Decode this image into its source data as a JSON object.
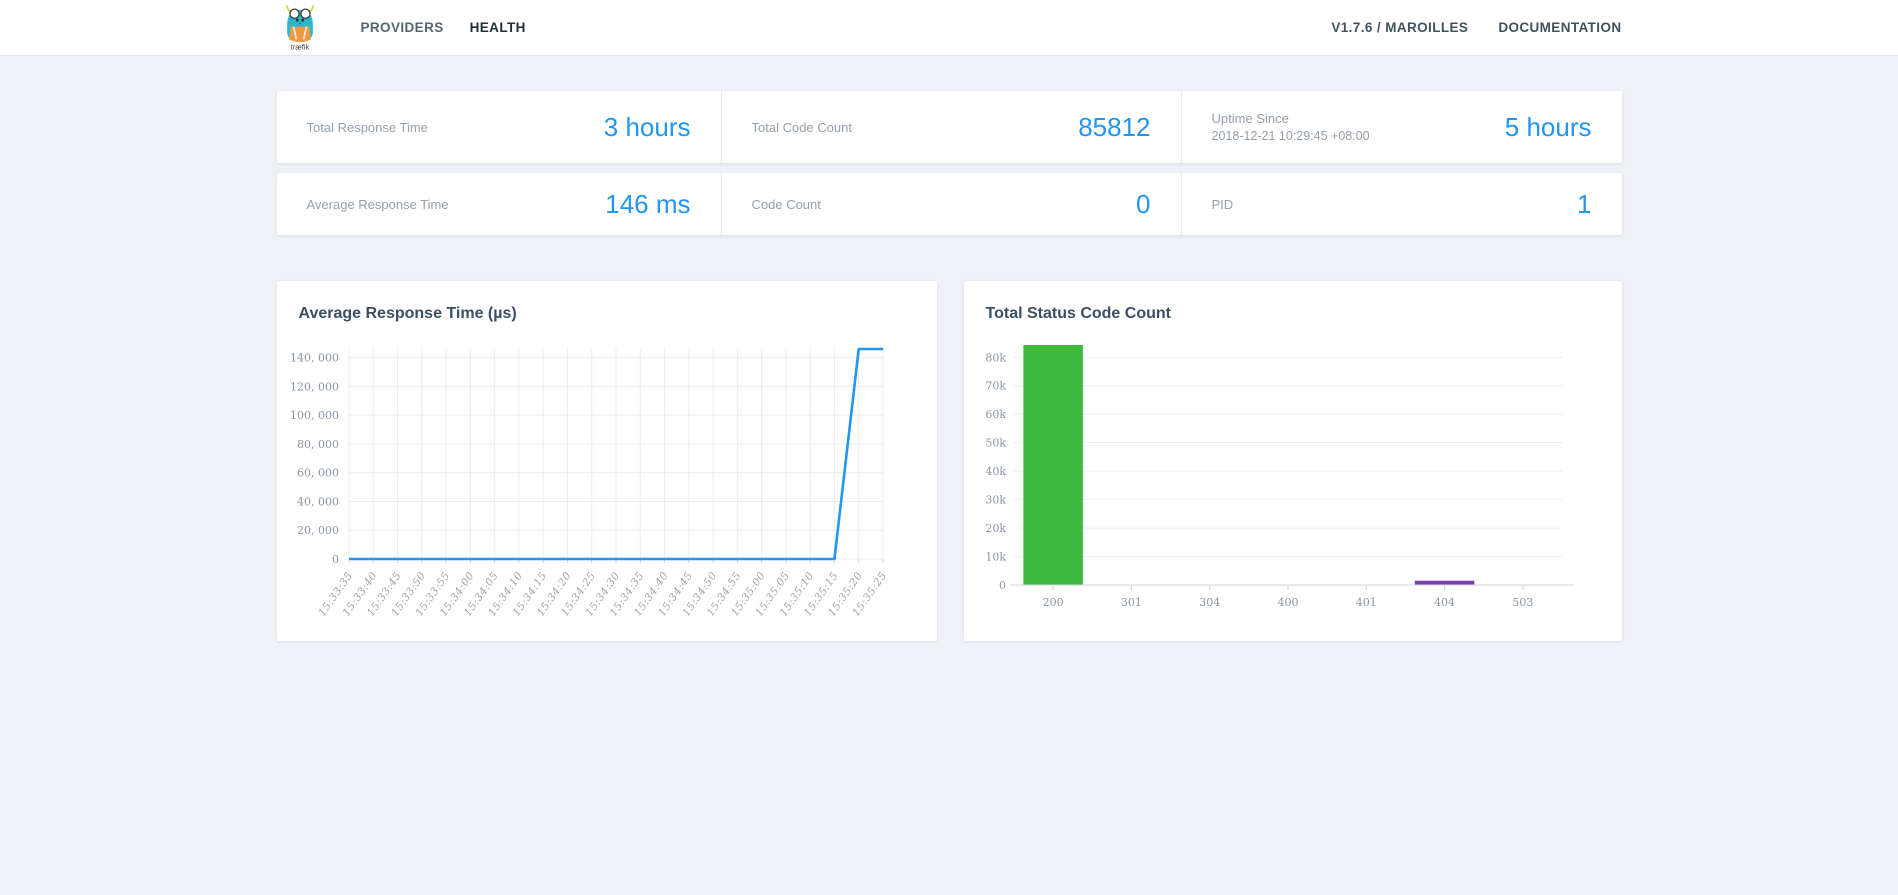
{
  "navbar": {
    "logo_text": "træfik",
    "links": [
      {
        "label": "PROVIDERS",
        "active": false
      },
      {
        "label": "HEALTH",
        "active": true
      }
    ],
    "version": "V1.7.6 / MAROILLES",
    "documentation": "DOCUMENTATION"
  },
  "stats": {
    "row1": [
      {
        "label": "Total Response Time",
        "value": "3 hours"
      },
      {
        "label": "Total Code Count",
        "value": "85812"
      },
      {
        "label": "Uptime Since",
        "sublabel": "2018-12-21 10:29:45 +08:00",
        "value": "5 hours"
      }
    ],
    "row2": [
      {
        "label": "Average Response Time",
        "value": "146 ms"
      },
      {
        "label": "Code Count",
        "value": "0"
      },
      {
        "label": "PID",
        "value": "1"
      }
    ]
  },
  "colors": {
    "accent_blue": "#2196f3",
    "bar_green": "#3eba3e",
    "bar_purple": "#7d3cae"
  },
  "chart_data": [
    {
      "type": "line",
      "title": "Average Response Time (µs)",
      "x": [
        "15:33:35",
        "15:33:40",
        "15:33:45",
        "15:33:50",
        "15:33:55",
        "15:34:00",
        "15:34:05",
        "15:34:10",
        "15:34:15",
        "15:34:20",
        "15:34:25",
        "15:34:30",
        "15:34:35",
        "15:34:40",
        "15:34:45",
        "15:34:50",
        "15:34:55",
        "15:35:00",
        "15:35:05",
        "15:35:10",
        "15:35:15",
        "15:35:20",
        "15:35:25"
      ],
      "values": [
        0,
        0,
        0,
        0,
        0,
        0,
        0,
        0,
        0,
        0,
        0,
        0,
        0,
        0,
        0,
        0,
        0,
        0,
        0,
        0,
        0,
        146000,
        146000
      ],
      "ylim": [
        0,
        146000
      ],
      "y_ticks": [
        [
          0,
          "0"
        ],
        [
          20000,
          "20, 000"
        ],
        [
          40000,
          "40, 000"
        ],
        [
          60000,
          "60, 000"
        ],
        [
          80000,
          "80, 000"
        ],
        [
          100000,
          "100, 000"
        ],
        [
          120000,
          "120, 000"
        ],
        [
          140000,
          "140, 000"
        ]
      ],
      "line_color": "#2196f3",
      "grid": true,
      "legend": "none"
    },
    {
      "type": "bar",
      "title": "Total Status Code Count",
      "categories": [
        "200",
        "301",
        "304",
        "400",
        "401",
        "404",
        "503"
      ],
      "values": [
        84312,
        0,
        0,
        0,
        0,
        1500,
        0
      ],
      "ylim": [
        0,
        84312
      ],
      "y_ticks": [
        [
          0,
          "0"
        ],
        [
          10000,
          "10k"
        ],
        [
          20000,
          "20k"
        ],
        [
          30000,
          "30k"
        ],
        [
          40000,
          "40k"
        ],
        [
          50000,
          "50k"
        ],
        [
          60000,
          "60k"
        ],
        [
          70000,
          "70k"
        ],
        [
          80000,
          "80k"
        ]
      ],
      "colors": {
        "200": "#3eba3e",
        "404": "#7d3cae"
      },
      "grid": true,
      "legend": "none"
    }
  ]
}
